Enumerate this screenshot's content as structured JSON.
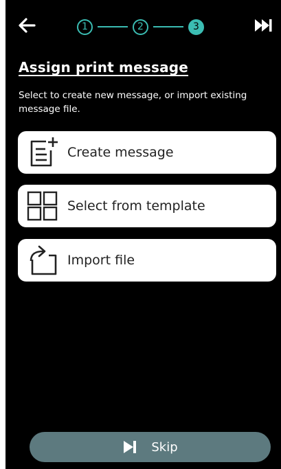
{
  "colors": {
    "background": "#000000",
    "accent": "#3bbdb3",
    "card": "#ffffff",
    "card_text": "#222222",
    "skip_button": "#5d7a7f"
  },
  "header": {
    "back_icon": "arrow-left-icon",
    "steps": [
      {
        "label": "1",
        "state": "completed"
      },
      {
        "label": "2",
        "state": "completed"
      },
      {
        "label": "3",
        "state": "current"
      }
    ],
    "skip_all_icon": "fast-forward-icon"
  },
  "page": {
    "title": "Assign print message",
    "description": "Select to create new message, or import existing message file."
  },
  "options": [
    {
      "label": "Create message",
      "icon": "new-document-icon"
    },
    {
      "label": "Select from template",
      "icon": "template-grid-icon"
    },
    {
      "label": "Import file",
      "icon": "import-file-icon"
    }
  ],
  "footer": {
    "skip_label": "Skip",
    "skip_icon": "skip-next-icon"
  }
}
